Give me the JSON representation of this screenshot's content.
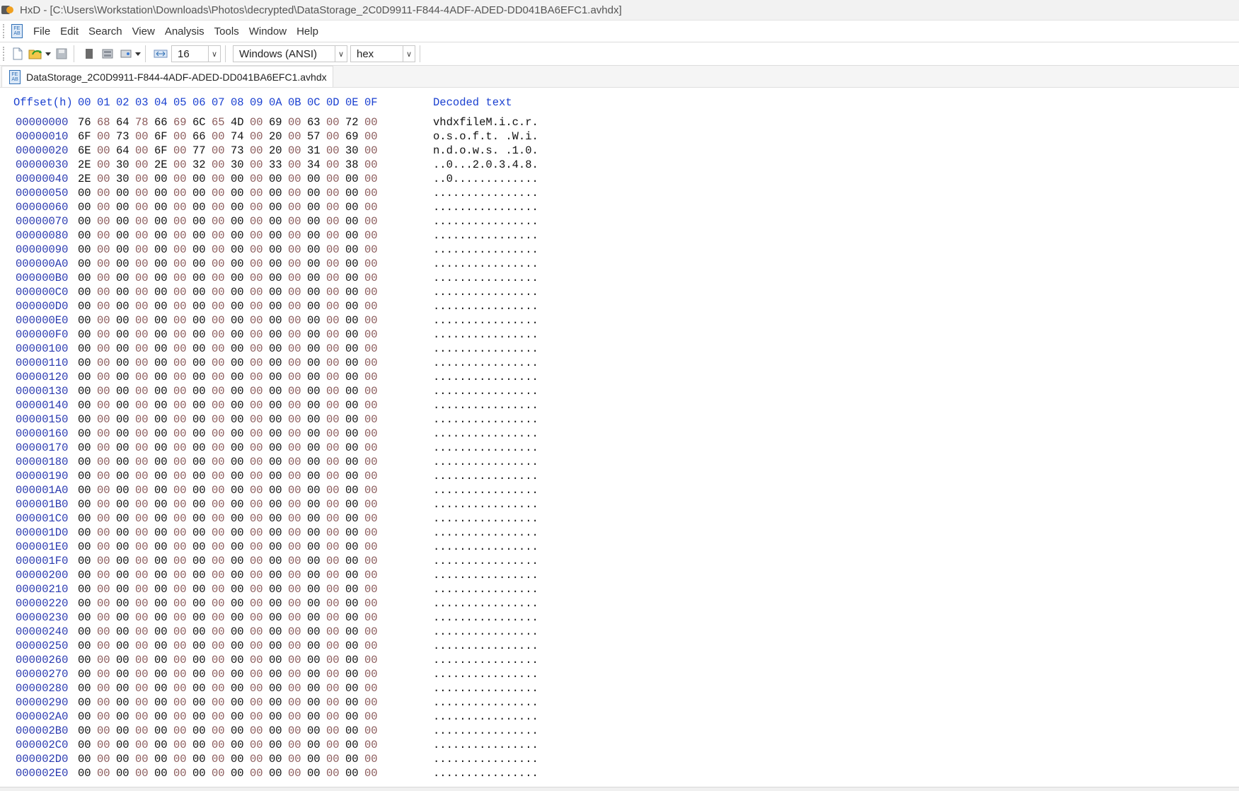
{
  "window": {
    "title": "HxD - [C:\\Users\\Workstation\\Downloads\\Photos\\decrypted\\DataStorage_2C0D9911-F844-4ADF-ADED-DD041BA6EFC1.avhdx]"
  },
  "menu": {
    "items": [
      "File",
      "Edit",
      "Search",
      "View",
      "Analysis",
      "Tools",
      "Window",
      "Help"
    ]
  },
  "toolbar": {
    "bytes_per_row": "16",
    "charset": "Windows (ANSI)",
    "offset_base": "hex",
    "icons": [
      "new-file-icon",
      "open-file-icon",
      "save-icon",
      "close-icon",
      "ram-icon",
      "disk-icon",
      "bytes-per-row-icon"
    ]
  },
  "tab": {
    "label": "DataStorage_2C0D9911-F844-4ADF-ADED-DD041BA6EFC1.avhdx"
  },
  "hex_view": {
    "header_offset": "Offset(h)",
    "header_columns": [
      "00",
      "01",
      "02",
      "03",
      "04",
      "05",
      "06",
      "07",
      "08",
      "09",
      "0A",
      "0B",
      "0C",
      "0D",
      "0E",
      "0F"
    ],
    "header_decoded": "Decoded text",
    "colors": {
      "header": "#1a40d0",
      "offset": "#2a3ab0",
      "odd_byte": "#8a5a5a"
    },
    "rows": [
      {
        "offset": "00000000",
        "bytes": [
          "76",
          "68",
          "64",
          "78",
          "66",
          "69",
          "6C",
          "65",
          "4D",
          "00",
          "69",
          "00",
          "63",
          "00",
          "72",
          "00"
        ],
        "text": "vhdxfileM.i.c.r."
      },
      {
        "offset": "00000010",
        "bytes": [
          "6F",
          "00",
          "73",
          "00",
          "6F",
          "00",
          "66",
          "00",
          "74",
          "00",
          "20",
          "00",
          "57",
          "00",
          "69",
          "00"
        ],
        "text": "o.s.o.f.t. .W.i."
      },
      {
        "offset": "00000020",
        "bytes": [
          "6E",
          "00",
          "64",
          "00",
          "6F",
          "00",
          "77",
          "00",
          "73",
          "00",
          "20",
          "00",
          "31",
          "00",
          "30",
          "00"
        ],
        "text": "n.d.o.w.s. .1.0."
      },
      {
        "offset": "00000030",
        "bytes": [
          "2E",
          "00",
          "30",
          "00",
          "2E",
          "00",
          "32",
          "00",
          "30",
          "00",
          "33",
          "00",
          "34",
          "00",
          "38",
          "00"
        ],
        "text": "..0...2.0.3.4.8."
      },
      {
        "offset": "00000040",
        "bytes": [
          "2E",
          "00",
          "30",
          "00",
          "00",
          "00",
          "00",
          "00",
          "00",
          "00",
          "00",
          "00",
          "00",
          "00",
          "00",
          "00"
        ],
        "text": "..0............."
      },
      {
        "offset": "00000050",
        "bytes": [
          "00",
          "00",
          "00",
          "00",
          "00",
          "00",
          "00",
          "00",
          "00",
          "00",
          "00",
          "00",
          "00",
          "00",
          "00",
          "00"
        ],
        "text": "................"
      },
      {
        "offset": "00000060",
        "bytes": [
          "00",
          "00",
          "00",
          "00",
          "00",
          "00",
          "00",
          "00",
          "00",
          "00",
          "00",
          "00",
          "00",
          "00",
          "00",
          "00"
        ],
        "text": "................"
      },
      {
        "offset": "00000070",
        "bytes": [
          "00",
          "00",
          "00",
          "00",
          "00",
          "00",
          "00",
          "00",
          "00",
          "00",
          "00",
          "00",
          "00",
          "00",
          "00",
          "00"
        ],
        "text": "................"
      },
      {
        "offset": "00000080",
        "bytes": [
          "00",
          "00",
          "00",
          "00",
          "00",
          "00",
          "00",
          "00",
          "00",
          "00",
          "00",
          "00",
          "00",
          "00",
          "00",
          "00"
        ],
        "text": "................"
      },
      {
        "offset": "00000090",
        "bytes": [
          "00",
          "00",
          "00",
          "00",
          "00",
          "00",
          "00",
          "00",
          "00",
          "00",
          "00",
          "00",
          "00",
          "00",
          "00",
          "00"
        ],
        "text": "................"
      },
      {
        "offset": "000000A0",
        "bytes": [
          "00",
          "00",
          "00",
          "00",
          "00",
          "00",
          "00",
          "00",
          "00",
          "00",
          "00",
          "00",
          "00",
          "00",
          "00",
          "00"
        ],
        "text": "................"
      },
      {
        "offset": "000000B0",
        "bytes": [
          "00",
          "00",
          "00",
          "00",
          "00",
          "00",
          "00",
          "00",
          "00",
          "00",
          "00",
          "00",
          "00",
          "00",
          "00",
          "00"
        ],
        "text": "................"
      },
      {
        "offset": "000000C0",
        "bytes": [
          "00",
          "00",
          "00",
          "00",
          "00",
          "00",
          "00",
          "00",
          "00",
          "00",
          "00",
          "00",
          "00",
          "00",
          "00",
          "00"
        ],
        "text": "................"
      },
      {
        "offset": "000000D0",
        "bytes": [
          "00",
          "00",
          "00",
          "00",
          "00",
          "00",
          "00",
          "00",
          "00",
          "00",
          "00",
          "00",
          "00",
          "00",
          "00",
          "00"
        ],
        "text": "................"
      },
      {
        "offset": "000000E0",
        "bytes": [
          "00",
          "00",
          "00",
          "00",
          "00",
          "00",
          "00",
          "00",
          "00",
          "00",
          "00",
          "00",
          "00",
          "00",
          "00",
          "00"
        ],
        "text": "................"
      },
      {
        "offset": "000000F0",
        "bytes": [
          "00",
          "00",
          "00",
          "00",
          "00",
          "00",
          "00",
          "00",
          "00",
          "00",
          "00",
          "00",
          "00",
          "00",
          "00",
          "00"
        ],
        "text": "................"
      },
      {
        "offset": "00000100",
        "bytes": [
          "00",
          "00",
          "00",
          "00",
          "00",
          "00",
          "00",
          "00",
          "00",
          "00",
          "00",
          "00",
          "00",
          "00",
          "00",
          "00"
        ],
        "text": "................"
      },
      {
        "offset": "00000110",
        "bytes": [
          "00",
          "00",
          "00",
          "00",
          "00",
          "00",
          "00",
          "00",
          "00",
          "00",
          "00",
          "00",
          "00",
          "00",
          "00",
          "00"
        ],
        "text": "................"
      },
      {
        "offset": "00000120",
        "bytes": [
          "00",
          "00",
          "00",
          "00",
          "00",
          "00",
          "00",
          "00",
          "00",
          "00",
          "00",
          "00",
          "00",
          "00",
          "00",
          "00"
        ],
        "text": "................"
      },
      {
        "offset": "00000130",
        "bytes": [
          "00",
          "00",
          "00",
          "00",
          "00",
          "00",
          "00",
          "00",
          "00",
          "00",
          "00",
          "00",
          "00",
          "00",
          "00",
          "00"
        ],
        "text": "................"
      },
      {
        "offset": "00000140",
        "bytes": [
          "00",
          "00",
          "00",
          "00",
          "00",
          "00",
          "00",
          "00",
          "00",
          "00",
          "00",
          "00",
          "00",
          "00",
          "00",
          "00"
        ],
        "text": "................"
      },
      {
        "offset": "00000150",
        "bytes": [
          "00",
          "00",
          "00",
          "00",
          "00",
          "00",
          "00",
          "00",
          "00",
          "00",
          "00",
          "00",
          "00",
          "00",
          "00",
          "00"
        ],
        "text": "................"
      },
      {
        "offset": "00000160",
        "bytes": [
          "00",
          "00",
          "00",
          "00",
          "00",
          "00",
          "00",
          "00",
          "00",
          "00",
          "00",
          "00",
          "00",
          "00",
          "00",
          "00"
        ],
        "text": "................"
      },
      {
        "offset": "00000170",
        "bytes": [
          "00",
          "00",
          "00",
          "00",
          "00",
          "00",
          "00",
          "00",
          "00",
          "00",
          "00",
          "00",
          "00",
          "00",
          "00",
          "00"
        ],
        "text": "................"
      },
      {
        "offset": "00000180",
        "bytes": [
          "00",
          "00",
          "00",
          "00",
          "00",
          "00",
          "00",
          "00",
          "00",
          "00",
          "00",
          "00",
          "00",
          "00",
          "00",
          "00"
        ],
        "text": "................"
      },
      {
        "offset": "00000190",
        "bytes": [
          "00",
          "00",
          "00",
          "00",
          "00",
          "00",
          "00",
          "00",
          "00",
          "00",
          "00",
          "00",
          "00",
          "00",
          "00",
          "00"
        ],
        "text": "................"
      },
      {
        "offset": "000001A0",
        "bytes": [
          "00",
          "00",
          "00",
          "00",
          "00",
          "00",
          "00",
          "00",
          "00",
          "00",
          "00",
          "00",
          "00",
          "00",
          "00",
          "00"
        ],
        "text": "................"
      },
      {
        "offset": "000001B0",
        "bytes": [
          "00",
          "00",
          "00",
          "00",
          "00",
          "00",
          "00",
          "00",
          "00",
          "00",
          "00",
          "00",
          "00",
          "00",
          "00",
          "00"
        ],
        "text": "................"
      },
      {
        "offset": "000001C0",
        "bytes": [
          "00",
          "00",
          "00",
          "00",
          "00",
          "00",
          "00",
          "00",
          "00",
          "00",
          "00",
          "00",
          "00",
          "00",
          "00",
          "00"
        ],
        "text": "................"
      },
      {
        "offset": "000001D0",
        "bytes": [
          "00",
          "00",
          "00",
          "00",
          "00",
          "00",
          "00",
          "00",
          "00",
          "00",
          "00",
          "00",
          "00",
          "00",
          "00",
          "00"
        ],
        "text": "................"
      },
      {
        "offset": "000001E0",
        "bytes": [
          "00",
          "00",
          "00",
          "00",
          "00",
          "00",
          "00",
          "00",
          "00",
          "00",
          "00",
          "00",
          "00",
          "00",
          "00",
          "00"
        ],
        "text": "................"
      },
      {
        "offset": "000001F0",
        "bytes": [
          "00",
          "00",
          "00",
          "00",
          "00",
          "00",
          "00",
          "00",
          "00",
          "00",
          "00",
          "00",
          "00",
          "00",
          "00",
          "00"
        ],
        "text": "................"
      },
      {
        "offset": "00000200",
        "bytes": [
          "00",
          "00",
          "00",
          "00",
          "00",
          "00",
          "00",
          "00",
          "00",
          "00",
          "00",
          "00",
          "00",
          "00",
          "00",
          "00"
        ],
        "text": "................"
      },
      {
        "offset": "00000210",
        "bytes": [
          "00",
          "00",
          "00",
          "00",
          "00",
          "00",
          "00",
          "00",
          "00",
          "00",
          "00",
          "00",
          "00",
          "00",
          "00",
          "00"
        ],
        "text": "................"
      },
      {
        "offset": "00000220",
        "bytes": [
          "00",
          "00",
          "00",
          "00",
          "00",
          "00",
          "00",
          "00",
          "00",
          "00",
          "00",
          "00",
          "00",
          "00",
          "00",
          "00"
        ],
        "text": "................"
      },
      {
        "offset": "00000230",
        "bytes": [
          "00",
          "00",
          "00",
          "00",
          "00",
          "00",
          "00",
          "00",
          "00",
          "00",
          "00",
          "00",
          "00",
          "00",
          "00",
          "00"
        ],
        "text": "................"
      },
      {
        "offset": "00000240",
        "bytes": [
          "00",
          "00",
          "00",
          "00",
          "00",
          "00",
          "00",
          "00",
          "00",
          "00",
          "00",
          "00",
          "00",
          "00",
          "00",
          "00"
        ],
        "text": "................"
      },
      {
        "offset": "00000250",
        "bytes": [
          "00",
          "00",
          "00",
          "00",
          "00",
          "00",
          "00",
          "00",
          "00",
          "00",
          "00",
          "00",
          "00",
          "00",
          "00",
          "00"
        ],
        "text": "................"
      },
      {
        "offset": "00000260",
        "bytes": [
          "00",
          "00",
          "00",
          "00",
          "00",
          "00",
          "00",
          "00",
          "00",
          "00",
          "00",
          "00",
          "00",
          "00",
          "00",
          "00"
        ],
        "text": "................"
      },
      {
        "offset": "00000270",
        "bytes": [
          "00",
          "00",
          "00",
          "00",
          "00",
          "00",
          "00",
          "00",
          "00",
          "00",
          "00",
          "00",
          "00",
          "00",
          "00",
          "00"
        ],
        "text": "................"
      },
      {
        "offset": "00000280",
        "bytes": [
          "00",
          "00",
          "00",
          "00",
          "00",
          "00",
          "00",
          "00",
          "00",
          "00",
          "00",
          "00",
          "00",
          "00",
          "00",
          "00"
        ],
        "text": "................"
      },
      {
        "offset": "00000290",
        "bytes": [
          "00",
          "00",
          "00",
          "00",
          "00",
          "00",
          "00",
          "00",
          "00",
          "00",
          "00",
          "00",
          "00",
          "00",
          "00",
          "00"
        ],
        "text": "................"
      },
      {
        "offset": "000002A0",
        "bytes": [
          "00",
          "00",
          "00",
          "00",
          "00",
          "00",
          "00",
          "00",
          "00",
          "00",
          "00",
          "00",
          "00",
          "00",
          "00",
          "00"
        ],
        "text": "................"
      },
      {
        "offset": "000002B0",
        "bytes": [
          "00",
          "00",
          "00",
          "00",
          "00",
          "00",
          "00",
          "00",
          "00",
          "00",
          "00",
          "00",
          "00",
          "00",
          "00",
          "00"
        ],
        "text": "................"
      },
      {
        "offset": "000002C0",
        "bytes": [
          "00",
          "00",
          "00",
          "00",
          "00",
          "00",
          "00",
          "00",
          "00",
          "00",
          "00",
          "00",
          "00",
          "00",
          "00",
          "00"
        ],
        "text": "................"
      },
      {
        "offset": "000002D0",
        "bytes": [
          "00",
          "00",
          "00",
          "00",
          "00",
          "00",
          "00",
          "00",
          "00",
          "00",
          "00",
          "00",
          "00",
          "00",
          "00",
          "00"
        ],
        "text": "................"
      },
      {
        "offset": "000002E0",
        "bytes": [
          "00",
          "00",
          "00",
          "00",
          "00",
          "00",
          "00",
          "00",
          "00",
          "00",
          "00",
          "00",
          "00",
          "00",
          "00",
          "00"
        ],
        "text": "................"
      }
    ]
  }
}
